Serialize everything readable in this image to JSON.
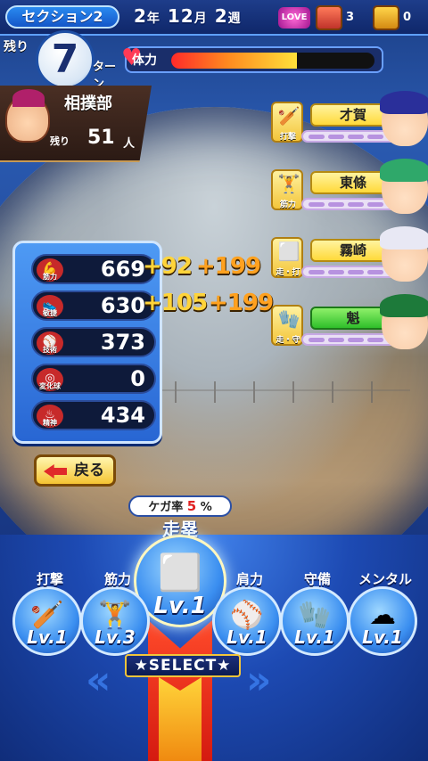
{
  "header": {
    "section": "セクション2",
    "date": {
      "year": "2",
      "year_unit": "年",
      "month": "12",
      "month_unit": "月",
      "week": "2",
      "week_unit": "週"
    },
    "love_label": "LOVE",
    "chest_red_count": "3",
    "chest_gold_count": "0"
  },
  "turn": {
    "remaining_label": "残り",
    "value": "7",
    "unit": "ターン"
  },
  "stamina": {
    "label": "体力",
    "level": 0.62
  },
  "club": {
    "name": "相撲部",
    "remaining_label": "残り",
    "remaining_count": "51",
    "unit": "人"
  },
  "teammates": [
    {
      "name": "才賀",
      "category": "打撃",
      "icon": "bat-icon",
      "hair": "#2a2f9a"
    },
    {
      "name": "東條",
      "category": "筋力",
      "icon": "dumbbell-icon",
      "hair": "#2fa86a"
    },
    {
      "name": "霧崎",
      "category": "走・打",
      "icon": "base-bat-icon",
      "hair": "#e8e8f4"
    },
    {
      "name": "魁",
      "category": "走・守",
      "icon": "base-glove-icon",
      "hair": "#1d7a3a"
    }
  ],
  "stats": [
    {
      "label": "筋力",
      "value": "669",
      "bonus1": "+92",
      "bonus2": "+199",
      "icon": "muscle-icon"
    },
    {
      "label": "敏捷",
      "value": "630",
      "bonus1": "+105",
      "bonus2": "+199",
      "icon": "shoe-icon"
    },
    {
      "label": "技術",
      "value": "373",
      "icon": "bat-icon"
    },
    {
      "label": "変化球",
      "value": "0",
      "icon": "ball-icon"
    },
    {
      "label": "精神",
      "value": "434",
      "icon": "spirit-icon"
    }
  ],
  "back_label": "戻る",
  "injury": {
    "label": "ケガ率",
    "value": "5",
    "unit": "%"
  },
  "selected_skill": {
    "name": "走塁",
    "level": "Lv.1"
  },
  "skills": [
    {
      "name": "打撃",
      "level": "Lv.1"
    },
    {
      "name": "筋力",
      "level": "Lv.3"
    },
    {
      "name": "肩力",
      "level": "Lv.1"
    },
    {
      "name": "守備",
      "level": "Lv.1"
    },
    {
      "name": "メンタル",
      "level": "Lv.1"
    }
  ],
  "select_label": "★SELECT★"
}
